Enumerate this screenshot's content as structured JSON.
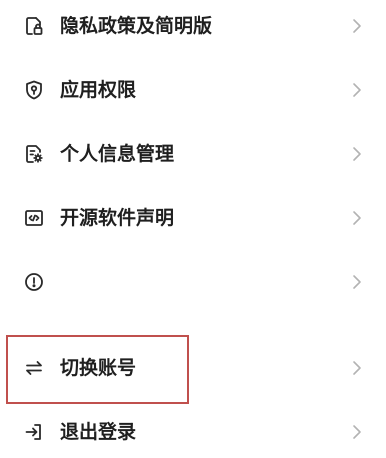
{
  "menu": {
    "items": [
      {
        "label": "隐私政策及简明版",
        "icon": "document-lock-icon"
      },
      {
        "label": "应用权限",
        "icon": "shield-icon"
      },
      {
        "label": "个人信息管理",
        "icon": "document-gear-icon"
      },
      {
        "label": "开源软件声明",
        "icon": "code-window-icon"
      },
      {
        "label": "",
        "icon": "info-circle-icon"
      },
      {
        "label": "切换账号",
        "icon": "switch-arrows-icon"
      },
      {
        "label": "退出登录",
        "icon": "logout-icon"
      }
    ]
  },
  "highlight": {
    "target": "切换账号",
    "color": "#c0504d"
  },
  "colors": {
    "text": "#1f1f1f",
    "icon": "#2a2a2a",
    "chevron": "#b3b3b3",
    "background": "#ffffff"
  }
}
